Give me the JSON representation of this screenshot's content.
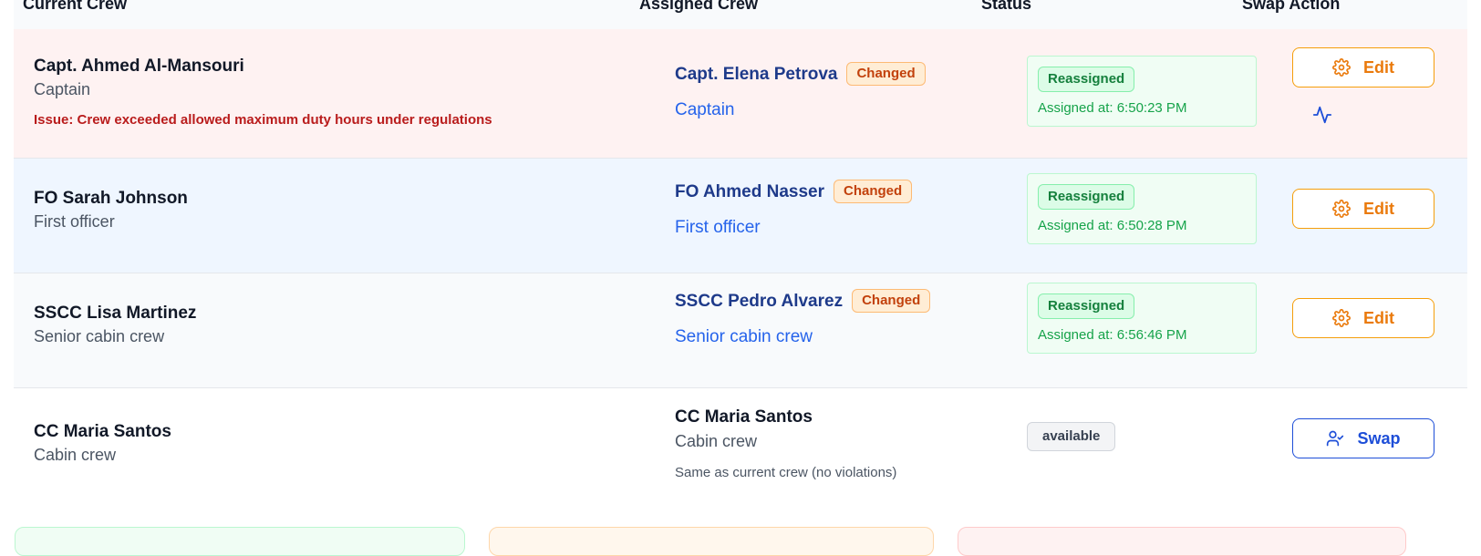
{
  "headers": {
    "current": "Current Crew",
    "assigned": "Assigned Crew",
    "status": "Status",
    "action": "Swap Action"
  },
  "rows": [
    {
      "current_name": "Capt. Ahmed Al-Mansouri",
      "current_role": "Captain",
      "issue": "Issue: Crew exceeded allowed maximum duty hours under regulations",
      "assigned_name": "Capt. Elena Petrova",
      "assigned_badge": "Changed",
      "assigned_role": "Captain",
      "status": "Reassigned",
      "assigned_at": "Assigned at: 6:50:23 PM",
      "action": "Edit"
    },
    {
      "current_name": "FO Sarah Johnson",
      "current_role": "First officer",
      "assigned_name": "FO Ahmed Nasser",
      "assigned_badge": "Changed",
      "assigned_role": "First officer",
      "status": "Reassigned",
      "assigned_at": "Assigned at: 6:50:28 PM",
      "action": "Edit"
    },
    {
      "current_name": "SSCC Lisa Martinez",
      "current_role": "Senior cabin crew",
      "assigned_name": "SSCC Pedro Alvarez",
      "assigned_badge": "Changed",
      "assigned_role": "Senior cabin crew",
      "status": "Reassigned",
      "assigned_at": "Assigned at: 6:56:46 PM",
      "action": "Edit"
    },
    {
      "current_name": "CC Maria Santos",
      "current_role": "Cabin crew",
      "assigned_name": "CC Maria Santos",
      "assigned_role": "Cabin crew",
      "assigned_note": "Same as current crew (no violations)",
      "status": "available",
      "action": "Swap"
    }
  ],
  "colors": {
    "issue_row_bg": "#fef2f2",
    "highlight_row_bg": "#eff6ff",
    "alt_row_bg": "#f8fafc",
    "changed_badge": "#ffedd5",
    "reassigned_badge": "#dcfce7",
    "edit_accent": "#ea7a0c",
    "swap_accent": "#1d4ed8"
  },
  "icons": {
    "edit": "gear-icon",
    "swap": "user-check-icon",
    "extra": "activity-icon"
  }
}
